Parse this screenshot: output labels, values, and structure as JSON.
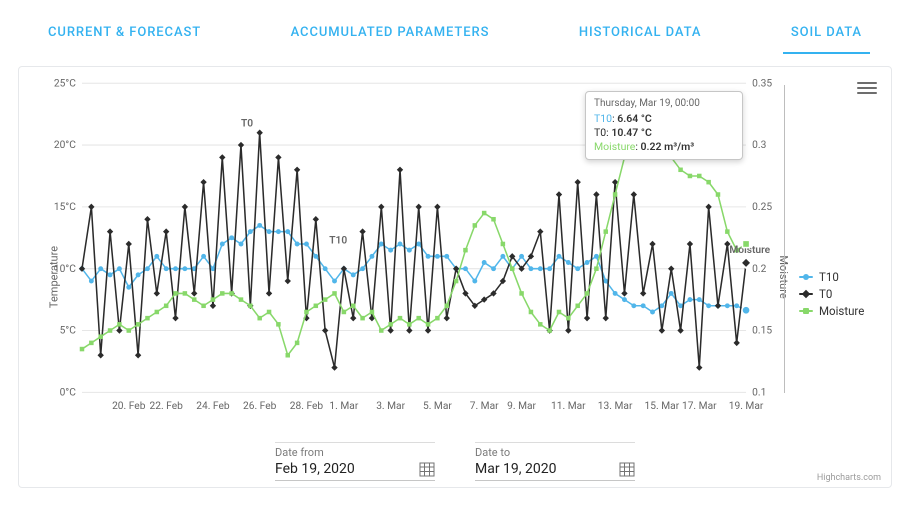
{
  "tabs": {
    "items": [
      {
        "label": "CURRENT & FORECAST",
        "active": false
      },
      {
        "label": "ACCUMULATED PARAMETERS",
        "active": false
      },
      {
        "label": "HISTORICAL DATA",
        "active": false
      },
      {
        "label": "SOIL DATA",
        "active": true
      }
    ]
  },
  "chart": {
    "y1_label": "Temperature",
    "y2_label": "Moisture",
    "credit": "Highcharts.com",
    "series_labels": {
      "t10_anno": "T10",
      "t0_anno": "T0",
      "moisture_anno": "Moisture"
    }
  },
  "legend": {
    "t10": "T10",
    "t0": "T0",
    "moisture": "Moisture"
  },
  "tooltip": {
    "date": "Thursday, Mar 19, 00:00",
    "t10_label": "T10",
    "t10_value": "6.64 °C",
    "t0_label": "T0",
    "t0_value": "10.47 °C",
    "moisture_label": "Moisture",
    "moisture_value": "0.22 m³/m³"
  },
  "date_range": {
    "from_label": "Date from",
    "from_value": "Feb 19, 2020",
    "to_label": "Date to",
    "to_value": "Mar 19, 2020"
  },
  "colors": {
    "t10": "#51b6ea",
    "t0": "#2b2b2b",
    "moisture": "#88d86a",
    "tab": "#34b2f0"
  },
  "chart_data": {
    "type": "line",
    "xlabel": "",
    "ylabel_left": "Temperature (°C)",
    "ylabel_right": "Moisture",
    "ylim_left": [
      0,
      25
    ],
    "ylim_right": [
      0.1,
      0.35
    ],
    "x_tick_labels": [
      "20. Feb",
      "22. Feb",
      "24. Feb",
      "26. Feb",
      "28. Feb",
      "1. Mar",
      "3. Mar",
      "5. Mar",
      "7. Mar",
      "9. Mar",
      "11. Mar",
      "13. Mar",
      "15. Mar",
      "17. Mar",
      "19. Mar"
    ],
    "y1_tick_labels": [
      "0°C",
      "5°C",
      "10°C",
      "15°C",
      "20°C",
      "25°C"
    ],
    "y2_tick_labels": [
      "0.1",
      "0.15",
      "0.2",
      "0.25",
      "0.3",
      "0.35"
    ],
    "series": [
      {
        "name": "T10",
        "axis": "left",
        "color": "#51b6ea",
        "values": [
          10,
          9,
          10,
          9.5,
          10,
          8.5,
          9.5,
          10,
          11,
          10,
          10,
          10,
          10,
          11,
          10,
          12,
          12.5,
          12,
          13,
          13.5,
          13,
          13,
          13,
          12,
          12,
          11,
          10,
          9,
          10,
          9.5,
          10,
          11,
          12,
          11.5,
          12,
          11.5,
          12,
          11,
          11,
          11,
          10,
          10,
          9,
          10.5,
          10,
          11,
          10,
          11,
          10,
          10,
          10,
          11,
          10.5,
          10,
          10.5,
          11,
          9,
          8,
          7.5,
          7,
          7,
          6.5,
          7,
          8,
          7,
          7.5,
          7.5,
          7,
          7,
          7,
          7,
          6.64
        ]
      },
      {
        "name": "T0",
        "axis": "left",
        "color": "#2b2b2b",
        "values": [
          10,
          15,
          3,
          13,
          5,
          12,
          3,
          14,
          8,
          13,
          6,
          15,
          8,
          17,
          7,
          19,
          8,
          20,
          7,
          21,
          8,
          19,
          9,
          18,
          6,
          14,
          5,
          2,
          10,
          6,
          13,
          6,
          15,
          5,
          18,
          5,
          15,
          5,
          15,
          6,
          10,
          8,
          7,
          7.5,
          8,
          9,
          11,
          10,
          11,
          13,
          5,
          16,
          5,
          17,
          6,
          16,
          6,
          17,
          8,
          16,
          8,
          12,
          5,
          10,
          5,
          12,
          2,
          15,
          7,
          12,
          4,
          10.47
        ]
      },
      {
        "name": "Moisture",
        "axis": "right",
        "color": "#88d86a",
        "values": [
          0.135,
          0.14,
          0.145,
          0.15,
          0.155,
          0.15,
          0.155,
          0.16,
          0.165,
          0.17,
          0.18,
          0.18,
          0.175,
          0.17,
          0.175,
          0.18,
          0.18,
          0.175,
          0.17,
          0.16,
          0.165,
          0.155,
          0.13,
          0.14,
          0.165,
          0.17,
          0.175,
          0.18,
          0.165,
          0.17,
          0.16,
          0.165,
          0.15,
          0.155,
          0.16,
          0.155,
          0.16,
          0.155,
          0.16,
          0.17,
          0.19,
          0.215,
          0.235,
          0.245,
          0.24,
          0.22,
          0.2,
          0.18,
          0.165,
          0.155,
          0.15,
          0.165,
          0.16,
          0.17,
          0.18,
          0.2,
          0.23,
          0.26,
          0.29,
          0.31,
          0.31,
          0.305,
          0.3,
          0.29,
          0.28,
          0.275,
          0.275,
          0.27,
          0.26,
          0.23,
          0.215,
          0.22
        ]
      }
    ]
  }
}
